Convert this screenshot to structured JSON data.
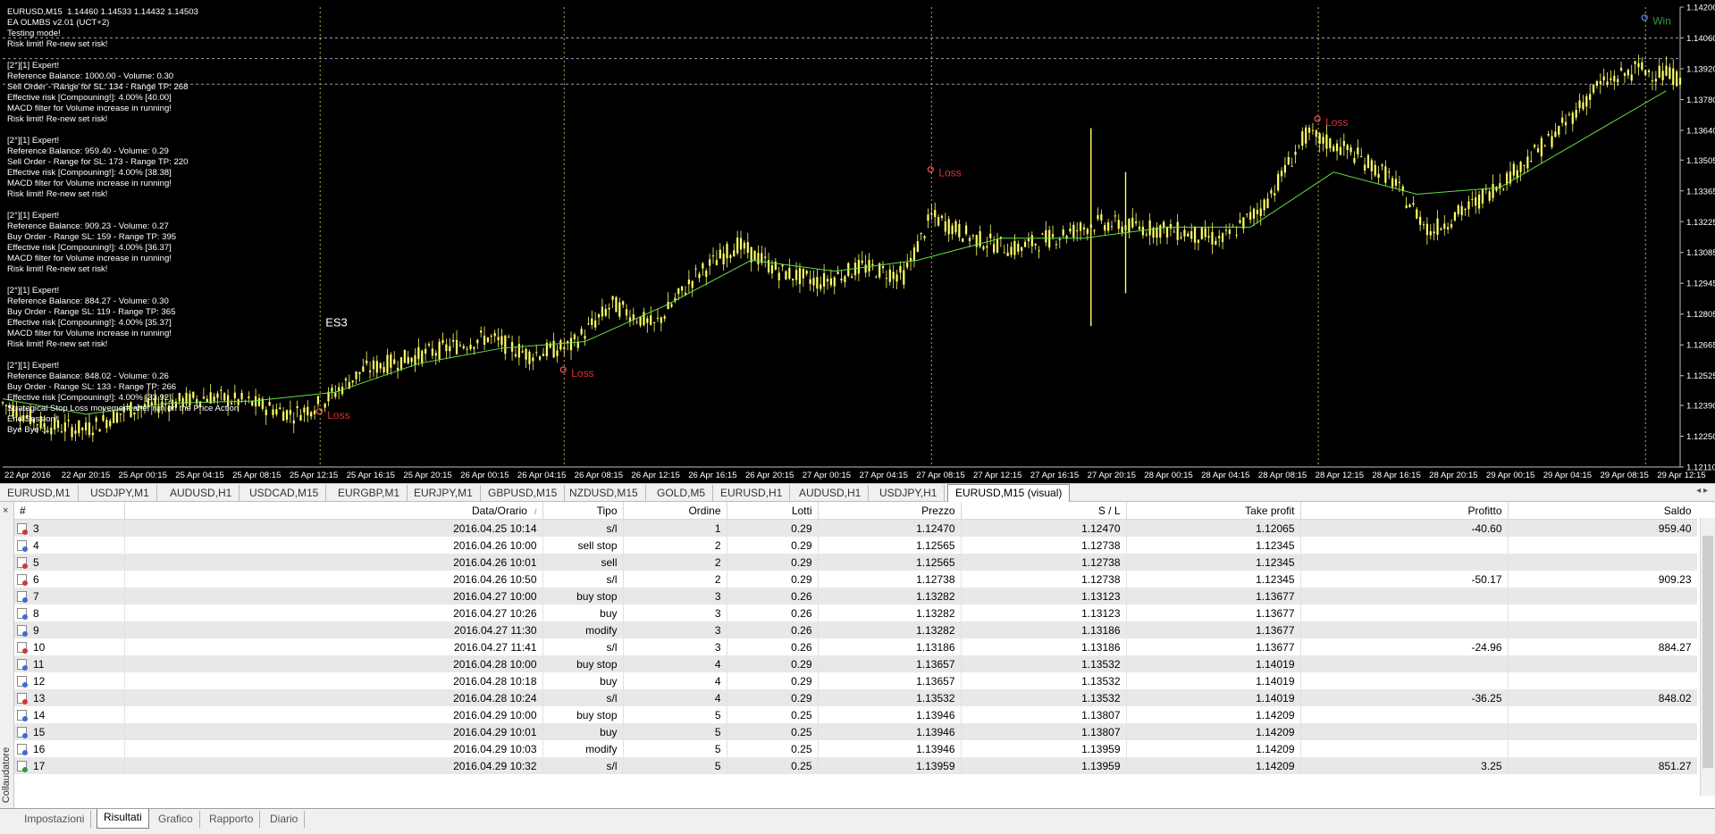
{
  "chart": {
    "info_lines": [
      "EURUSD,M15  1.14460 1.14533 1.14432 1.14503",
      "EA OLMBS v2.01 (UCT+2)",
      "Testing mode!",
      "Risk limit! Re-new set risk!",
      "",
      "[2°][1] Expert!",
      "Reference Balance: 1000.00 - Volume: 0.30",
      "Sell Order - Range for SL: 134 - Range TP: 268",
      "Effective risk [Compouning!]: 4.00% [40.00]",
      "MACD filter for Volume increase in running!",
      "Risk limit! Re-new set risk!",
      "",
      "[2°][1] Expert!",
      "Reference Balance: 959.40 - Volume: 0.29",
      "Sell Order - Range for SL: 173 - Range TP: 220",
      "Effective risk [Compouning!]: 4.00% [38.38]",
      "MACD filter for Volume increase in running!",
      "Risk limit! Re-new set risk!",
      "",
      "[2°][1] Expert!",
      "Reference Balance: 909.23 - Volume: 0.27",
      "Buy Order - Range SL: 159 - Range TP: 395",
      "Effective risk [Compouning!]: 4.00% [36.37]",
      "MACD filter for Volume increase in running!",
      "Risk limit! Re-new set risk!",
      "",
      "[2°][1] Expert!",
      "Reference Balance: 884.27 - Volume: 0.30",
      "Buy Order - Range SL: 119 - Range TP: 365",
      "Effective risk [Compouning!]: 4.00% [35.37]",
      "MACD filter for Volume increase in running!",
      "Risk limit! Re-new set risk!",
      "",
      "[2°][1] Expert!",
      "Reference Balance: 848.02 - Volume: 0.26",
      "Buy Order - Range SL: 133 - Range TP: 266",
      "Effective risk [Compouning!]: 4.00% [33.92]",
      "Strategical Stop Loss movement after run on the Price Action",
      "End Session!",
      "Bye Bye :)"
    ],
    "marker_es3": "ES3",
    "trade_labels": [
      {
        "text": "Loss",
        "color": "#e03030",
        "t": 22.9,
        "price": 1.1233
      },
      {
        "text": "Loss",
        "color": "#e03030",
        "t": 40.5,
        "price": 1.1252
      },
      {
        "text": "Loss",
        "color": "#e03030",
        "t": 67.0,
        "price": 1.1343
      },
      {
        "text": "Loss",
        "color": "#e03030",
        "t": 94.9,
        "price": 1.1366
      },
      {
        "text": "Win",
        "color": "#2f9a3a",
        "t": 118.5,
        "price": 1.1412
      }
    ]
  },
  "chart_data": {
    "type": "candlestick",
    "symbol": "EURUSD",
    "timeframe": "M15",
    "y_ticks": [
      "1.14200",
      "1.14060",
      "1.13920",
      "1.13780",
      "1.13640",
      "1.13505",
      "1.13365",
      "1.13225",
      "1.13085",
      "1.12945",
      "1.12805",
      "1.12665",
      "1.12525",
      "1.12390",
      "1.12250",
      "1.12110"
    ],
    "ylim": [
      1.1211,
      1.142
    ],
    "x_ticks": [
      "22 Apr 2016",
      "22 Apr 20:15",
      "25 Apr 00:15",
      "25 Apr 04:15",
      "25 Apr 08:15",
      "25 Apr 12:15",
      "25 Apr 16:15",
      "25 Apr 20:15",
      "26 Apr 00:15",
      "26 Apr 04:15",
      "26 Apr 08:15",
      "26 Apr 12:15",
      "26 Apr 16:15",
      "26 Apr 20:15",
      "27 Apr 00:15",
      "27 Apr 04:15",
      "27 Apr 08:15",
      "27 Apr 12:15",
      "27 Apr 16:15",
      "27 Apr 20:15",
      "28 Apr 00:15",
      "28 Apr 04:15",
      "28 Apr 08:15",
      "28 Apr 12:15",
      "28 Apr 16:15",
      "28 Apr 20:15",
      "29 Apr 00:15",
      "29 Apr 04:15",
      "29 Apr 08:15",
      "29 Apr 12:15"
    ],
    "price_path": [
      [
        0,
        1.124
      ],
      [
        3,
        1.123
      ],
      [
        6,
        1.1228
      ],
      [
        9,
        1.1237
      ],
      [
        12,
        1.124
      ],
      [
        15,
        1.1243
      ],
      [
        18,
        1.124
      ],
      [
        21,
        1.1235
      ],
      [
        23,
        1.124
      ],
      [
        26,
        1.1255
      ],
      [
        29,
        1.126
      ],
      [
        32,
        1.1265
      ],
      [
        35,
        1.127
      ],
      [
        38,
        1.1262
      ],
      [
        41,
        1.1266
      ],
      [
        44,
        1.1285
      ],
      [
        47,
        1.1275
      ],
      [
        50,
        1.1298
      ],
      [
        53,
        1.1312
      ],
      [
        56,
        1.13
      ],
      [
        59,
        1.1295
      ],
      [
        62,
        1.1302
      ],
      [
        65,
        1.1298
      ],
      [
        67,
        1.1325
      ],
      [
        70,
        1.1315
      ],
      [
        73,
        1.131
      ],
      [
        76,
        1.1316
      ],
      [
        79,
        1.1322
      ],
      [
        82,
        1.132
      ],
      [
        85,
        1.1318
      ],
      [
        88,
        1.1314
      ],
      [
        91,
        1.133
      ],
      [
        94,
        1.1362
      ],
      [
        97,
        1.1355
      ],
      [
        100,
        1.1343
      ],
      [
        103,
        1.1318
      ],
      [
        106,
        1.133
      ],
      [
        109,
        1.1345
      ],
      [
        112,
        1.1362
      ],
      [
        115,
        1.1384
      ],
      [
        118,
        1.1392
      ],
      [
        121,
        1.1388
      ]
    ],
    "ma_path": [
      [
        0,
        1.1242
      ],
      [
        6,
        1.1235
      ],
      [
        12,
        1.124
      ],
      [
        18,
        1.1241
      ],
      [
        24,
        1.1245
      ],
      [
        30,
        1.1258
      ],
      [
        36,
        1.1265
      ],
      [
        42,
        1.1268
      ],
      [
        48,
        1.1285
      ],
      [
        54,
        1.1305
      ],
      [
        60,
        1.13
      ],
      [
        66,
        1.1305
      ],
      [
        72,
        1.1315
      ],
      [
        78,
        1.1315
      ],
      [
        84,
        1.132
      ],
      [
        90,
        1.132
      ],
      [
        96,
        1.1345
      ],
      [
        102,
        1.1335
      ],
      [
        108,
        1.1338
      ],
      [
        114,
        1.136
      ],
      [
        120,
        1.1382
      ]
    ],
    "spikes": [
      {
        "t": 78.5,
        "high": 1.1365,
        "low": 1.1275
      },
      {
        "t": 81.0,
        "high": 1.1345,
        "low": 1.129
      }
    ],
    "vlines_t": [
      22.9,
      40.5,
      67.0,
      94.9,
      118.5
    ]
  },
  "chart_tabs": {
    "items": [
      "EURUSD,M1",
      "USDJPY,M1",
      "AUDUSD,H1",
      "USDCAD,M15",
      "EURGBP,M1",
      "EURJPY,M1",
      "GBPUSD,M15",
      "NZDUSD,M15",
      "GOLD,M5",
      "EURUSD,H1",
      "AUDUSD,H1",
      "USDJPY,H1",
      "EURUSD,M15 (visual)"
    ],
    "active_index": 12
  },
  "results_table": {
    "close_symbol": "×",
    "side_label": "Collaudatore",
    "columns": [
      "#",
      "Data/Orario",
      "Tipo",
      "Ordine",
      "Lotti",
      "Prezzo",
      "S / L",
      "Take profit",
      "Profitto",
      "Saldo"
    ],
    "sort_indicator": "/",
    "rows": [
      {
        "id": "3",
        "icon": "sl",
        "date": "2016.04.25 10:14",
        "type": "s/l",
        "order": "1",
        "lots": "0.29",
        "price": "1.12470",
        "sl": "1.12470",
        "tp": "1.12065",
        "profit": "-40.60",
        "balance": "959.40"
      },
      {
        "id": "4",
        "icon": "order",
        "date": "2016.04.26 10:00",
        "type": "sell stop",
        "order": "2",
        "lots": "0.29",
        "price": "1.12565",
        "sl": "1.12738",
        "tp": "1.12345",
        "profit": "",
        "balance": ""
      },
      {
        "id": "5",
        "icon": "sl",
        "date": "2016.04.26 10:01",
        "type": "sell",
        "order": "2",
        "lots": "0.29",
        "price": "1.12565",
        "sl": "1.12738",
        "tp": "1.12345",
        "profit": "",
        "balance": ""
      },
      {
        "id": "6",
        "icon": "sl",
        "date": "2016.04.26 10:50",
        "type": "s/l",
        "order": "2",
        "lots": "0.29",
        "price": "1.12738",
        "sl": "1.12738",
        "tp": "1.12345",
        "profit": "-50.17",
        "balance": "909.23"
      },
      {
        "id": "7",
        "icon": "order",
        "date": "2016.04.27 10:00",
        "type": "buy stop",
        "order": "3",
        "lots": "0.26",
        "price": "1.13282",
        "sl": "1.13123",
        "tp": "1.13677",
        "profit": "",
        "balance": ""
      },
      {
        "id": "8",
        "icon": "order",
        "date": "2016.04.27 10:26",
        "type": "buy",
        "order": "3",
        "lots": "0.26",
        "price": "1.13282",
        "sl": "1.13123",
        "tp": "1.13677",
        "profit": "",
        "balance": ""
      },
      {
        "id": "9",
        "icon": "order",
        "date": "2016.04.27 11:30",
        "type": "modify",
        "order": "3",
        "lots": "0.26",
        "price": "1.13282",
        "sl": "1.13186",
        "tp": "1.13677",
        "profit": "",
        "balance": ""
      },
      {
        "id": "10",
        "icon": "sl",
        "date": "2016.04.27 11:41",
        "type": "s/l",
        "order": "3",
        "lots": "0.26",
        "price": "1.13186",
        "sl": "1.13186",
        "tp": "1.13677",
        "profit": "-24.96",
        "balance": "884.27"
      },
      {
        "id": "11",
        "icon": "order",
        "date": "2016.04.28 10:00",
        "type": "buy stop",
        "order": "4",
        "lots": "0.29",
        "price": "1.13657",
        "sl": "1.13532",
        "tp": "1.14019",
        "profit": "",
        "balance": ""
      },
      {
        "id": "12",
        "icon": "order",
        "date": "2016.04.28 10:18",
        "type": "buy",
        "order": "4",
        "lots": "0.29",
        "price": "1.13657",
        "sl": "1.13532",
        "tp": "1.14019",
        "profit": "",
        "balance": ""
      },
      {
        "id": "13",
        "icon": "sl",
        "date": "2016.04.28 10:24",
        "type": "s/l",
        "order": "4",
        "lots": "0.29",
        "price": "1.13532",
        "sl": "1.13532",
        "tp": "1.14019",
        "profit": "-36.25",
        "balance": "848.02"
      },
      {
        "id": "14",
        "icon": "order",
        "date": "2016.04.29 10:00",
        "type": "buy stop",
        "order": "5",
        "lots": "0.25",
        "price": "1.13946",
        "sl": "1.13807",
        "tp": "1.14209",
        "profit": "",
        "balance": ""
      },
      {
        "id": "15",
        "icon": "order",
        "date": "2016.04.29 10:01",
        "type": "buy",
        "order": "5",
        "lots": "0.25",
        "price": "1.13946",
        "sl": "1.13807",
        "tp": "1.14209",
        "profit": "",
        "balance": ""
      },
      {
        "id": "16",
        "icon": "order",
        "date": "2016.04.29 10:03",
        "type": "modify",
        "order": "5",
        "lots": "0.25",
        "price": "1.13946",
        "sl": "1.13959",
        "tp": "1.14209",
        "profit": "",
        "balance": ""
      },
      {
        "id": "17",
        "icon": "tp",
        "date": "2016.04.29 10:32",
        "type": "s/l",
        "order": "5",
        "lots": "0.25",
        "price": "1.13959",
        "sl": "1.13959",
        "tp": "1.14209",
        "profit": "3.25",
        "balance": "851.27"
      }
    ]
  },
  "bottom_tabs": {
    "items": [
      "Impostazioni",
      "Risultati",
      "Grafico",
      "Rapporto",
      "Diario"
    ],
    "active_index": 1
  },
  "colors": {
    "candle": "#ffff66",
    "moving_average": "#66dd44",
    "grid_dash": "#8aa0b8",
    "vertical_dash": "#b8a84a",
    "axis_text": "#ffffff"
  }
}
